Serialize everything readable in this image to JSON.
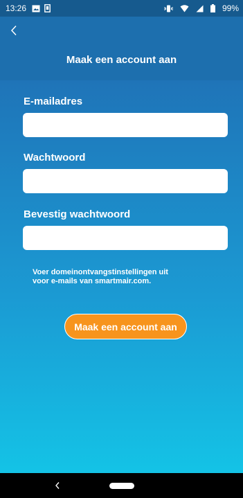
{
  "status_bar": {
    "time": "13:26",
    "battery": "99%",
    "icons": [
      "image-notification-icon",
      "sim-notification-icon",
      "vibrate-icon",
      "wifi-icon",
      "signal-icon",
      "battery-icon"
    ]
  },
  "app_bar": {
    "back_icon": "chevron-left-icon",
    "title": "Maak een account aan"
  },
  "form": {
    "email_label": "E-mailadres",
    "email_value": "",
    "password_label": "Wachtwoord",
    "password_value": "",
    "confirm_label": "Bevestig wachtwoord",
    "confirm_value": "",
    "note_line1": "Voer domeinontvangstinstellingen uit",
    "note_line2": "voor e-mails van smartmair.com.",
    "submit_label": "Maak een account aan"
  },
  "nav_bar": {
    "back_icon": "nav-back-icon",
    "home_icon": "home-pill-icon"
  },
  "colors": {
    "accent": "#f7941d",
    "header": "#1d6fae",
    "status_bar": "#165a8e",
    "gradient_top": "#1f74b8",
    "gradient_bottom": "#14c3e6"
  }
}
